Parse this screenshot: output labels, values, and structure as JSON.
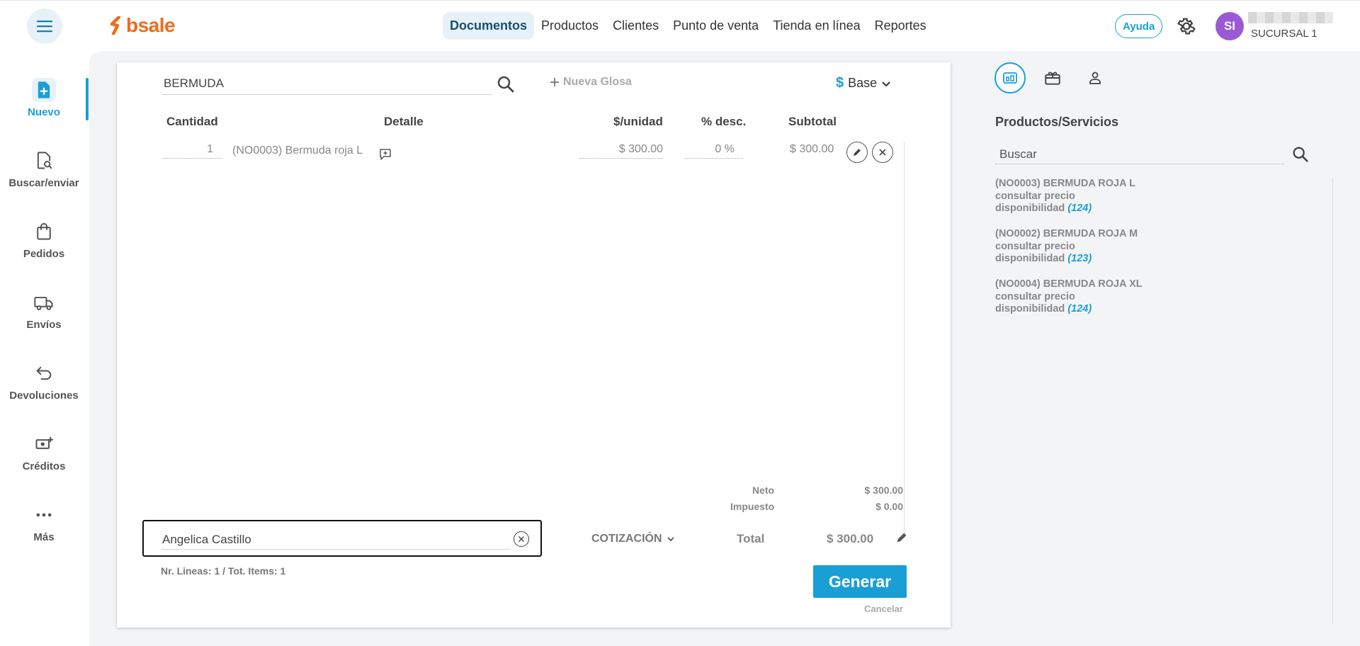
{
  "topbar": {
    "logo_text": "bsale",
    "nav": [
      {
        "label": "Documentos",
        "active": true
      },
      {
        "label": "Productos",
        "active": false
      },
      {
        "label": "Clientes",
        "active": false
      },
      {
        "label": "Punto de venta",
        "active": false
      },
      {
        "label": "Tienda en línea",
        "active": false
      },
      {
        "label": "Reportes",
        "active": false
      }
    ],
    "help_label": "Ayuda",
    "avatar_initials": "SI",
    "branch": "SUCURSAL 1"
  },
  "sidebar": {
    "items": [
      {
        "label": "Nuevo",
        "icon": "new-document-icon",
        "active": true
      },
      {
        "label": "Buscar/enviar",
        "icon": "search-document-icon",
        "active": false
      },
      {
        "label": "Pedidos",
        "icon": "shopping-bag-icon",
        "active": false
      },
      {
        "label": "Envíos",
        "icon": "truck-icon",
        "active": false
      },
      {
        "label": "Devoluciones",
        "icon": "return-arrow-icon",
        "active": false
      },
      {
        "label": "Créditos",
        "icon": "cash-plus-icon",
        "active": false
      },
      {
        "label": "Más",
        "icon": "more-dots-icon",
        "active": false
      }
    ]
  },
  "document": {
    "search_value": "BERMUDA",
    "new_gloss_label": "Nueva Glosa",
    "price_list": {
      "symbol": "$",
      "label": "Base"
    },
    "columns": {
      "quantity": "Cantidad",
      "detail": "Detalle",
      "unit_price": "$/unidad",
      "discount": "% desc.",
      "subtotal": "Subtotal"
    },
    "lines": [
      {
        "quantity": "1",
        "detail": "(NO0003) Bermuda roja L",
        "unit_price": "$ 300.00",
        "discount": "0 %",
        "subtotal": "$ 300.00"
      }
    ],
    "totals": {
      "net_label": "Neto",
      "net_value": "$ 300.00",
      "tax_label": "Impuesto",
      "tax_value": "$ 0.00",
      "total_label": "Total",
      "total_value": "$ 300.00"
    },
    "client_value": "Angelica Castillo",
    "doc_type": "COTIZACIÓN",
    "lines_info": "Nr. Lineas: 1 / Tot. Items: 1",
    "generate_label": "Generar",
    "cancel_label": "Cancelar"
  },
  "right_panel": {
    "title": "Productos/Servicios",
    "search_value": "Buscar",
    "products": [
      {
        "name": "(NO0003) BERMUDA ROJA L",
        "price": "consultar precio",
        "availability_label": "disponibilidad",
        "availability": "(124)"
      },
      {
        "name": "(NO0002) BERMUDA ROJA M",
        "price": "consultar precio",
        "availability_label": "disponibilidad",
        "availability": "(123)"
      },
      {
        "name": "(NO0004) BERMUDA ROJA XL",
        "price": "consultar precio",
        "availability_label": "disponibilidad",
        "availability": "(124)"
      }
    ]
  },
  "colors": {
    "accent": "#1a9fd4",
    "brand": "#f26a1b",
    "avatar": "#9b59d6"
  }
}
